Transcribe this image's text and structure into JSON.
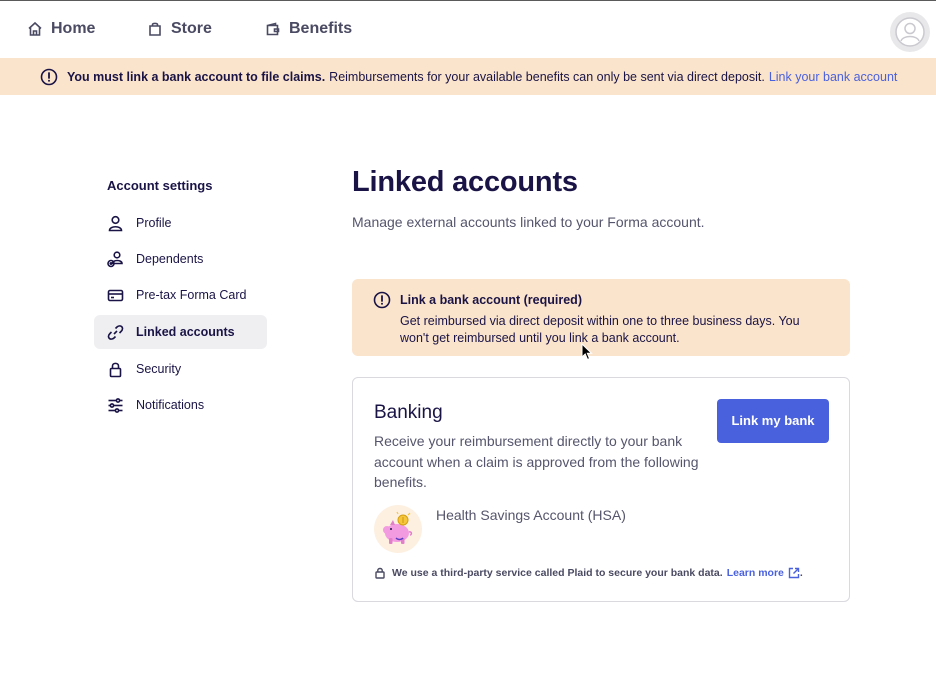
{
  "nav": {
    "home": "Home",
    "store": "Store",
    "benefits": "Benefits"
  },
  "banner": {
    "bold": "You must link a bank account to file claims.",
    "text": "Reimbursements for your available benefits can only be sent via direct deposit.",
    "link": "Link your bank account"
  },
  "sidebar": {
    "title": "Account settings",
    "items": [
      {
        "label": "Profile",
        "icon": "person-icon"
      },
      {
        "label": "Dependents",
        "icon": "dependents-icon"
      },
      {
        "label": "Pre-tax Forma Card",
        "icon": "card-icon"
      },
      {
        "label": "Linked accounts",
        "icon": "link-icon",
        "active": true
      },
      {
        "label": "Security",
        "icon": "lock-icon"
      },
      {
        "label": "Notifications",
        "icon": "sliders-icon"
      }
    ]
  },
  "main": {
    "title": "Linked accounts",
    "subtitle": "Manage external accounts linked to your Forma account."
  },
  "warning": {
    "title": "Link a bank account (required)",
    "text": "Get reimbursed via direct deposit within one to three business days. You won't get reimbursed until you link a bank account."
  },
  "banking": {
    "title": "Banking",
    "description": "Receive your reimbursement directly to your bank account when a claim is approved from the following benefits.",
    "button": "Link my bank",
    "benefit": "Health Savings Account (HSA)",
    "plaid_text": "We use a third-party service called Plaid to secure your bank data.",
    "learn_more": "Learn more",
    "plaid_end": "."
  },
  "colors": {
    "accent": "#4a61dd",
    "warning_bg": "#fbe4cc",
    "text_dark": "#1a1446"
  }
}
